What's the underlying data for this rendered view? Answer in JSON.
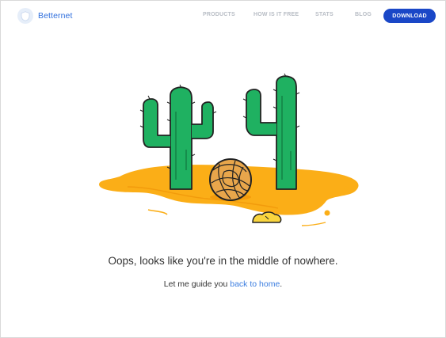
{
  "brand": {
    "name": "Betternet",
    "icon": "shield-icon",
    "color": "#2f6fdd"
  },
  "nav": {
    "items": [
      "PRODUCTS",
      "HOW IS IT FREE",
      "STATS",
      "BLOG"
    ],
    "download_label": "DOWNLOAD",
    "download_color": "#1a47c7"
  },
  "illustration": {
    "icon": "cactus-desert-illustration",
    "colors": {
      "sand": "#fbae17",
      "cactus": "#1fb161",
      "tumbleweed": "#e8a64b"
    }
  },
  "error": {
    "message": "Oops, looks like you're in the middle of nowhere.",
    "guide_prefix": "Let me guide you ",
    "guide_link": "back to home",
    "guide_suffix": "."
  }
}
